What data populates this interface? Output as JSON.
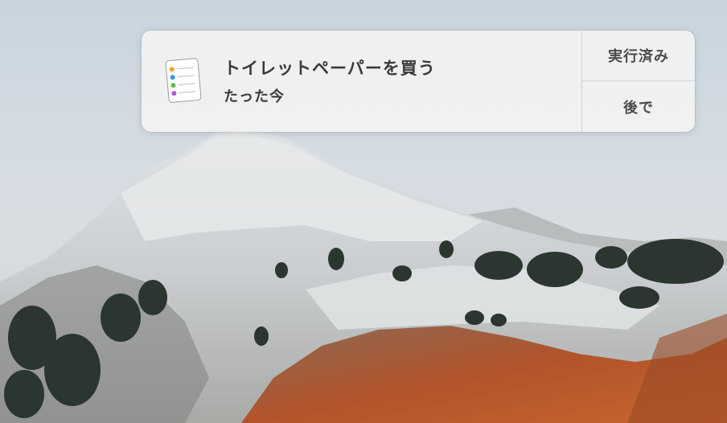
{
  "notification": {
    "app_icon": "reminders-icon",
    "title": "トイレットペーパーを買う",
    "time": "たった今",
    "actions": {
      "done_label": "実行済み",
      "later_label": "後で"
    }
  },
  "wallpaper": {
    "description_icon": "mountain-wallpaper",
    "colors": {
      "sky": "#cdd7e0",
      "snow": "#e9ecee",
      "rock": "#8c8a86",
      "trees": "#2f3a33",
      "autumn": "#b2542b"
    }
  }
}
